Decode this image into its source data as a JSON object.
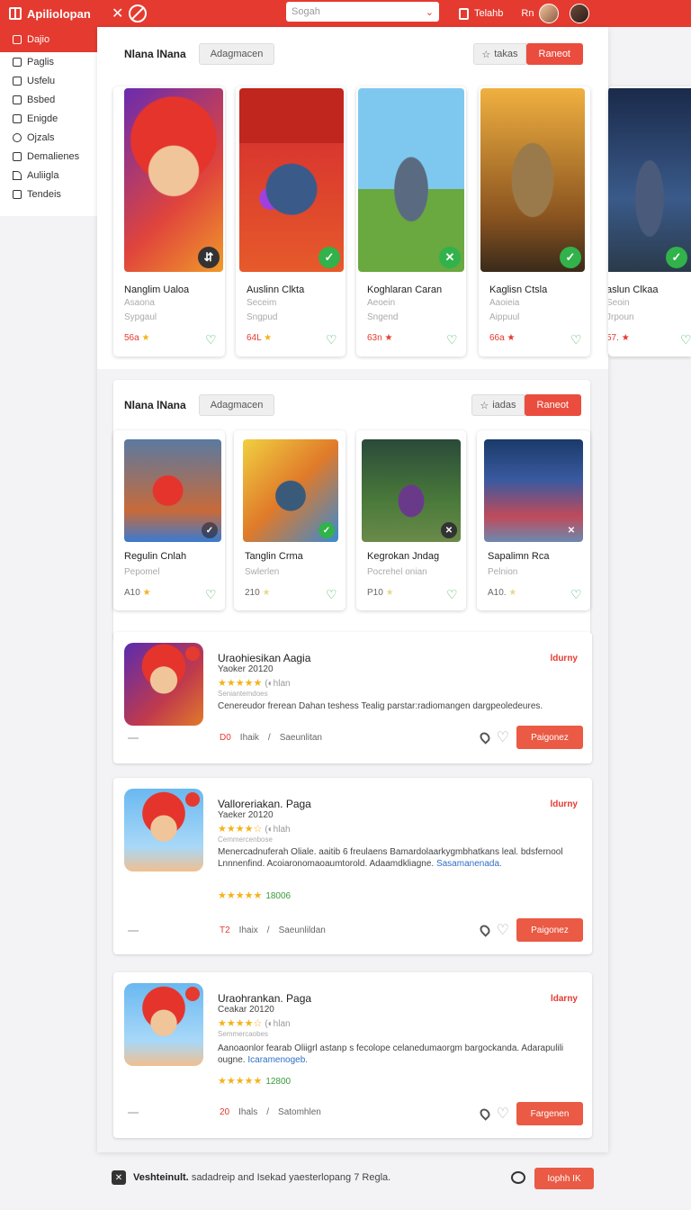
{
  "app": {
    "brand": "Apiliolopan"
  },
  "topbar": {
    "search_placeholder": "Sogah",
    "user_label": "Telahb",
    "user_short": "Rn"
  },
  "sidebar": {
    "items": [
      {
        "label": "Dajio"
      },
      {
        "label": "Paglis"
      },
      {
        "label": "Usfelu"
      },
      {
        "label": "Bsbed"
      },
      {
        "label": "Enigde"
      },
      {
        "label": "Ojzals"
      },
      {
        "label": "Demalienes"
      },
      {
        "label": "Auliigla"
      },
      {
        "label": "Tendeis"
      }
    ]
  },
  "section1": {
    "title": "Nlana lNana",
    "filter_label": "Adagmacen",
    "star_label": "takas",
    "action_label": "Raneot",
    "cards": [
      {
        "name": "Nanglim Ualoa",
        "sub1": "Asaona",
        "sub2": "Sypgaul",
        "rating": "56a",
        "badge": "⇵"
      },
      {
        "name": "Auslinn Clkta",
        "sub1": "Seceim",
        "sub2": "Sngpud",
        "rating": "64L",
        "badge": "✓"
      },
      {
        "name": "Koghlaran Caran",
        "sub1": "Aeoein",
        "sub2": "Sngend",
        "rating": "63n",
        "badge": "✕"
      },
      {
        "name": "Kaglisn Ctsla",
        "sub1": "Aaoieia",
        "sub2": "Aippuul",
        "rating": "66a",
        "badge": "✓"
      },
      {
        "name": "aslun Clkaa",
        "sub1": "Seoin",
        "sub2": "Jrpoun",
        "rating": "57.",
        "badge": "✓"
      }
    ]
  },
  "section2": {
    "title": "Nlana lNana",
    "filter_label": "Adagmacen",
    "star_label": "iadas",
    "action_label": "Raneot",
    "cards": [
      {
        "name": "Regulin Cnlah",
        "sub": "Pepomel",
        "rating": "A10",
        "badge": "✓"
      },
      {
        "name": "Tanglin Crma",
        "sub": "Swlerlen",
        "rating": "210",
        "badge": "✓"
      },
      {
        "name": "Kegrokan Jndag",
        "sub": "Pocrehel onian",
        "rating": "P10",
        "badge": "✕"
      },
      {
        "name": "Sapalimn Rca",
        "sub": "Pelnion",
        "rating": "A10.",
        "badge": "✕"
      }
    ]
  },
  "list": [
    {
      "title": "Uraohiesikan Aagia",
      "sub": "Yaoker 20120",
      "stars": "★★★★★",
      "stars_text": "(◐hlan",
      "tiny": "Seniantemdoes",
      "desc": "Cenereudor frerean Dahan teshess Tealig parstar:radiomangen dargpeoledeures.",
      "link": "",
      "rating_stars": "",
      "rating_num": "",
      "tag": "ldurny",
      "count": "D0",
      "count_unit": "Ihaik",
      "sep": "/",
      "author": "Saeunlitan",
      "pay": "Paigonez"
    },
    {
      "title": "Valloreriakan. Paga",
      "sub": "Yaeker 20120",
      "stars": "★★★★☆",
      "stars_text": "(◐hlah",
      "tiny": "Cemmercenbose",
      "desc": "Menercadnuferah Oliale. aaitib 6 freulaens Bamardolaarkygmbhatkans leal. bdsfernool Lnnnenfind. Acoiaronomaoaumtorold. Adaamdkliagne.",
      "link": "Sasamanenada.",
      "rating_stars": "★★★★★",
      "rating_num": "18006",
      "tag": "ldurny",
      "count": "T2",
      "count_unit": "Ihaix",
      "sep": "/",
      "author": "Saeunlildan",
      "pay": "Paigonez"
    },
    {
      "title": "Uraohrankan. Paga",
      "sub": "Ceakar 20120",
      "stars": "★★★★☆",
      "stars_text": "(◐hlan",
      "tiny": "Semmercaobes",
      "desc": "Aanoaonlor fearab Oliigrl astanp s fecolope celanedumaorgm bargockanda. Adarapulili ougne.",
      "link": "Icaramenogeb.",
      "rating_stars": "★★★★★",
      "rating_num": "12800",
      "tag": "ldarny",
      "count": "20",
      "count_unit": "Ihals",
      "sep": "/",
      "author": "Satomhlen",
      "pay": "Fargenen"
    }
  ],
  "footer": {
    "title": "Veshteinult.",
    "text": "sadadreip and Isekad yaesterlopang 7 Regla.",
    "button": "Iophh IK"
  },
  "colors": {
    "accent": "#e53a30",
    "good": "#31b24a",
    "star": "#f3b31a"
  }
}
